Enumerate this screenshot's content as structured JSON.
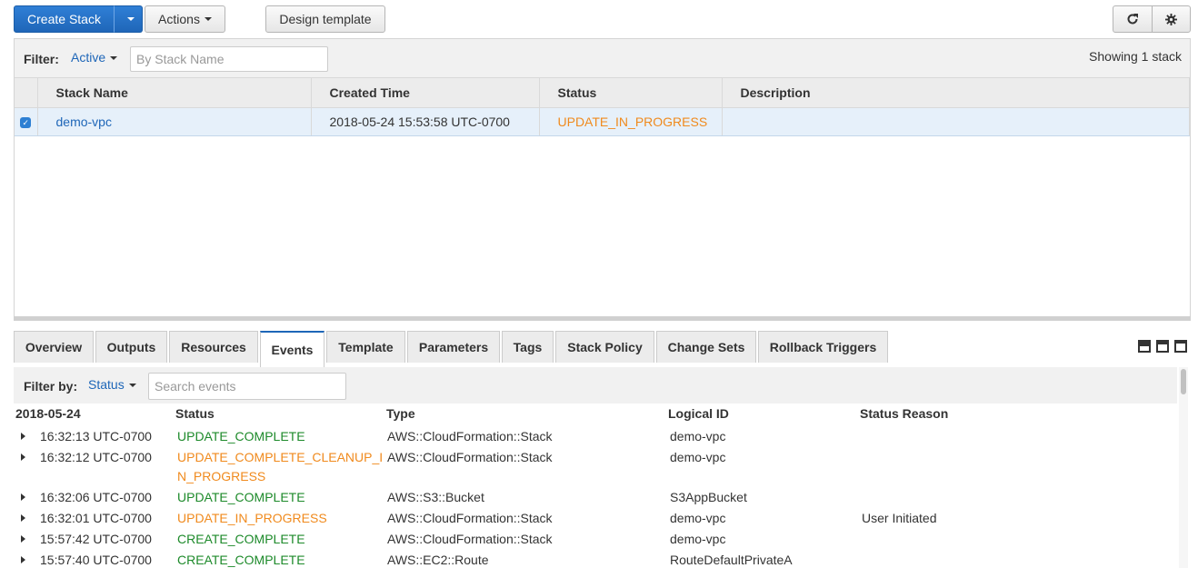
{
  "toolbar": {
    "create_stack": "Create Stack",
    "actions": "Actions",
    "design_template": "Design template"
  },
  "stack_filter": {
    "label": "Filter:",
    "value": "Active",
    "placeholder": "By Stack Name",
    "showing": "Showing 1 stack"
  },
  "stack_table": {
    "headers": [
      "Stack Name",
      "Created Time",
      "Status",
      "Description"
    ],
    "rows": [
      {
        "name": "demo-vpc",
        "created": "2018-05-24 15:53:58 UTC-0700",
        "status": "UPDATE_IN_PROGRESS",
        "description": "",
        "selected": true
      }
    ]
  },
  "tabs": [
    {
      "label": "Overview"
    },
    {
      "label": "Outputs"
    },
    {
      "label": "Resources"
    },
    {
      "label": "Events"
    },
    {
      "label": "Template"
    },
    {
      "label": "Parameters"
    },
    {
      "label": "Tags"
    },
    {
      "label": "Stack Policy"
    },
    {
      "label": "Change Sets"
    },
    {
      "label": "Rollback Triggers"
    }
  ],
  "active_tab": "Events",
  "events_filter": {
    "label": "Filter by:",
    "value": "Status",
    "placeholder": "Search events"
  },
  "events": {
    "date": "2018-05-24",
    "headers": [
      "Status",
      "Type",
      "Logical ID",
      "Status Reason"
    ],
    "rows": [
      {
        "time": "16:32:13 UTC-0700",
        "status": [
          "UPDATE_COMPLETE"
        ],
        "type": "AWS::CloudFormation::Stack",
        "logical_id": "demo-vpc",
        "reason": ""
      },
      {
        "time": "16:32:12 UTC-0700",
        "status": [
          "UPDATE_COMPLETE_CLEANUP_I",
          "N_PROGRESS"
        ],
        "type": "AWS::CloudFormation::Stack",
        "logical_id": "demo-vpc",
        "reason": ""
      },
      {
        "time": "16:32:06 UTC-0700",
        "status": [
          "UPDATE_COMPLETE"
        ],
        "type": "AWS::S3::Bucket",
        "logical_id": "S3AppBucket",
        "reason": ""
      },
      {
        "time": "16:32:01 UTC-0700",
        "status": [
          "UPDATE_IN_PROGRESS"
        ],
        "type": "AWS::CloudFormation::Stack",
        "logical_id": "demo-vpc",
        "reason": "User Initiated"
      },
      {
        "time": "15:57:42 UTC-0700",
        "status": [
          "CREATE_COMPLETE"
        ],
        "type": "AWS::CloudFormation::Stack",
        "logical_id": "demo-vpc",
        "reason": ""
      },
      {
        "time": "15:57:40 UTC-0700",
        "status": [
          "CREATE_COMPLETE"
        ],
        "type": "AWS::EC2::Route",
        "logical_id": "RouteDefaultPrivateA",
        "reason": ""
      }
    ]
  },
  "colors": {
    "primary": "#1f66b8",
    "in_progress": "#f08a1d",
    "complete": "#1d8a2a",
    "selected_row": "#e6f0fa"
  },
  "icons": {
    "refresh": "refresh-icon",
    "settings": "gear-icon",
    "expand": "triangle-right-icon",
    "view_modes": [
      "layout-bottom-icon",
      "layout-split-icon",
      "layout-top-icon"
    ]
  }
}
